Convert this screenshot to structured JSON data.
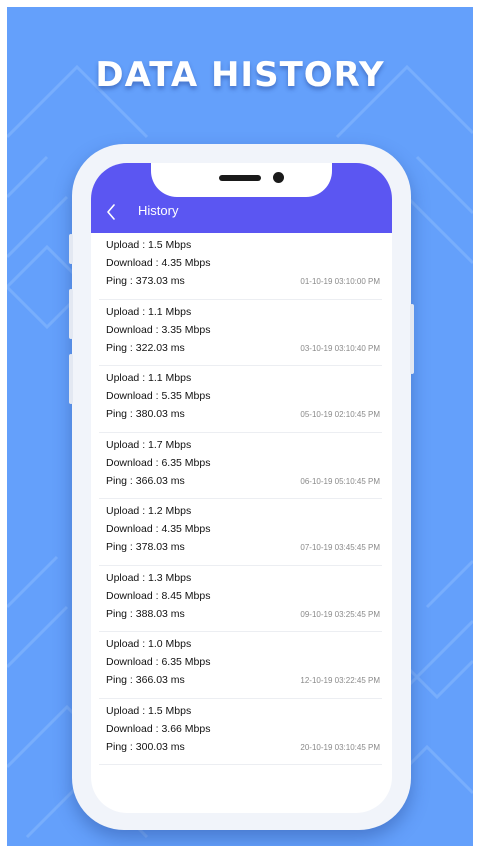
{
  "headline": "DATA HISTORY",
  "appbar": {
    "title": "History",
    "back_icon": "chevron-left-icon"
  },
  "colors": {
    "background": "#64a0fb",
    "appbar": "#5b56f2",
    "pattern": "#7fb3fd"
  },
  "history": [
    {
      "upload": "Upload : 1.5 Mbps",
      "download": "Download  : 4.35 Mbps",
      "ping": "Ping : 373.03 ms",
      "timestamp": "01-10-19 03:10:00 PM"
    },
    {
      "upload": "Upload : 1.1 Mbps",
      "download": "Download  : 3.35 Mbps",
      "ping": "Ping : 322.03 ms",
      "timestamp": "03-10-19 03:10:40 PM"
    },
    {
      "upload": "Upload : 1.1 Mbps",
      "download": "Download  : 5.35 Mbps",
      "ping": "Ping : 380.03 ms",
      "timestamp": "05-10-19 02:10:45 PM"
    },
    {
      "upload": "Upload : 1.7 Mbps",
      "download": "Download  : 6.35 Mbps",
      "ping": "Ping : 366.03 ms",
      "timestamp": "06-10-19 05:10:45 PM"
    },
    {
      "upload": "Upload : 1.2 Mbps",
      "download": "Download  : 4.35 Mbps",
      "ping": "Ping : 378.03 ms",
      "timestamp": "07-10-19 03:45:45 PM"
    },
    {
      "upload": "Upload : 1.3 Mbps",
      "download": "Download  : 8.45 Mbps",
      "ping": "Ping : 388.03 ms",
      "timestamp": "09-10-19 03:25:45 PM"
    },
    {
      "upload": "Upload : 1.0 Mbps",
      "download": "Download  : 6.35 Mbps",
      "ping": "Ping : 366.03 ms",
      "timestamp": "12-10-19 03:22:45 PM"
    },
    {
      "upload": "Upload : 1.5 Mbps",
      "download": "Download  : 3.66 Mbps",
      "ping": "Ping : 300.03 ms",
      "timestamp": "20-10-19 03:10:45 PM"
    }
  ]
}
